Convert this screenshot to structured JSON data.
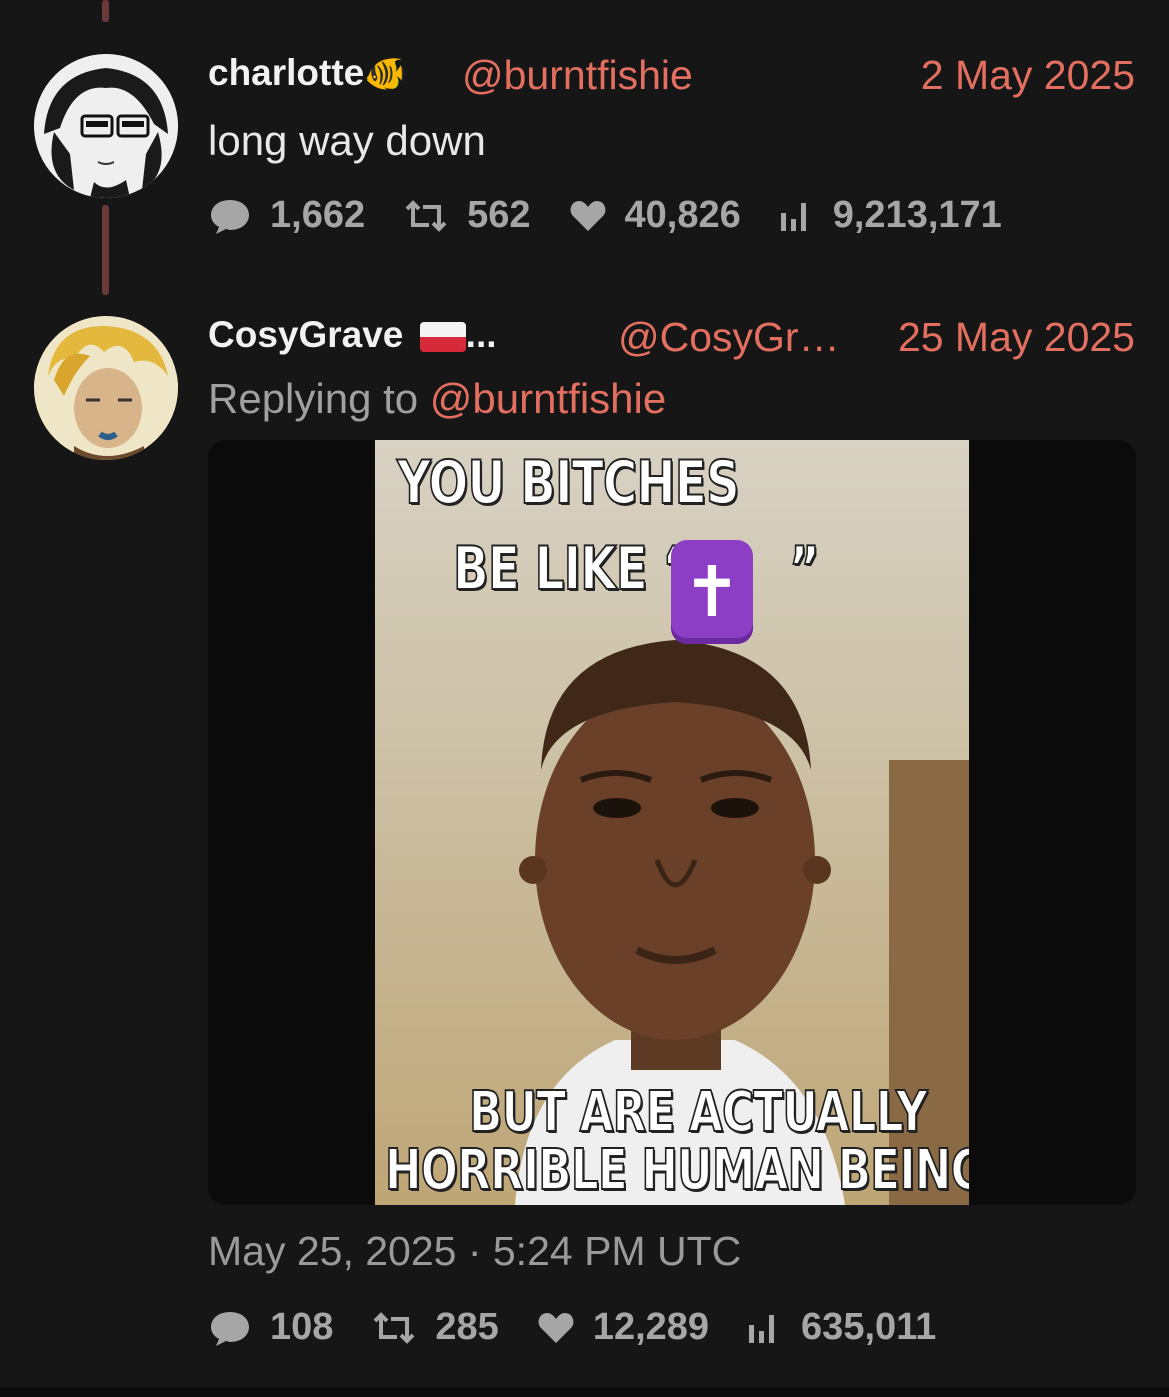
{
  "tweet1": {
    "name": "charlotte",
    "name_emoji": "🐠",
    "handle": "@burntfishie",
    "date": "2 May 2025",
    "text": "long way down",
    "stats": {
      "replies": "1,662",
      "retweets": "562",
      "likes": "40,826",
      "views": "9,213,171"
    }
  },
  "tweet2": {
    "name": "CosyGrave",
    "name_flag": "🇵🇱",
    "name_ellipsis": "...",
    "handle": "@CosyGr…",
    "date": "25 May 2025",
    "reply_prefix": "Replying to ",
    "reply_handle": "@burntfishie",
    "meme": {
      "top_line1": "YOU BITCHES",
      "top_line2": "BE LIKE “",
      "top_quote_close": "”",
      "emoji": "✝",
      "bottom_line1": "BUT ARE ACTUALLY",
      "bottom_line2": "HORRIBLE HUMAN BEINGS"
    },
    "timestamp": "May 25, 2025 · 5:24 PM UTC",
    "stats": {
      "replies": "108",
      "retweets": "285",
      "likes": "12,289",
      "views": "635,011"
    }
  },
  "colors": {
    "accent": "#e26f5f",
    "background": "#161616",
    "muted": "#a6a6a6"
  }
}
